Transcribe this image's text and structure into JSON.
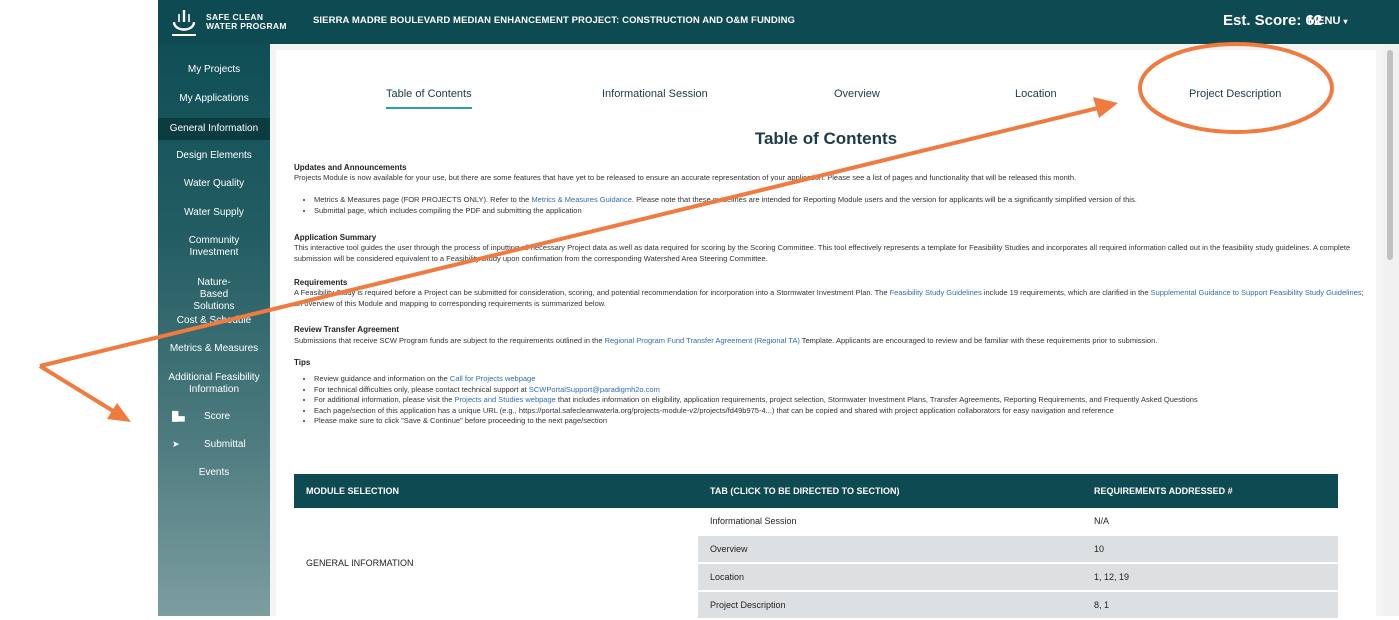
{
  "header": {
    "logo_line1": "SAFE CLEAN",
    "logo_line2": "WATER PROGRAM",
    "project_title": "SIERRA MADRE BOULEVARD MEDIAN ENHANCEMENT PROJECT:  CONSTRUCTION AND O&M FUNDING",
    "score": "Est. Score: 62",
    "menu": "MENU"
  },
  "sidebar": {
    "items": [
      {
        "label": "My Projects"
      },
      {
        "label": "My Applications"
      },
      {
        "label": "General Information"
      },
      {
        "label": "Design Elements"
      },
      {
        "label": "Water Quality"
      },
      {
        "label": "Water Supply"
      },
      {
        "label": "Community Investment"
      },
      {
        "label": "Nature-Based Solutions"
      },
      {
        "label": "Cost & Schedule"
      },
      {
        "label": "Metrics & Measures"
      },
      {
        "label": "Additional Feasibility Information"
      },
      {
        "label": "Score"
      },
      {
        "label": "Submittal"
      },
      {
        "label": "Events"
      }
    ]
  },
  "tabs": [
    {
      "label": "Table of Contents"
    },
    {
      "label": "Informational Session"
    },
    {
      "label": "Overview"
    },
    {
      "label": "Location"
    },
    {
      "label": "Project Description"
    }
  ],
  "content": {
    "heading": "Table of Contents",
    "updates_title": "Updates and Announcements",
    "updates_text": "Projects Module is now available for your use, but there are some features that have yet to be released to ensure an accurate representation of your application. Please see a list of pages and functionality that will be released this month.",
    "updates_b1_pre": "Metrics & Measures page (FOR PROJECTS ONLY). Refer to the ",
    "updates_b1_link": "Metrics & Measures Guidance",
    "updates_b1_post": ". Please note that these guidelines are intended for Reporting Module users and the version for applicants will be a significantly simplified version of this.",
    "updates_b2": "Submittal page, which includes compiling the PDF and submitting the application",
    "summary_title": "Application Summary",
    "summary_text": "This interactive tool guides the user through the process of inputting all necessary Project data as well as data required for scoring by the Scoring Committee. This tool effectively represents a template for Feasibility Studies and incorporates all required information called out in the feasibility study guidelines. A complete submission will be considered equivalent to a Feasibility Study upon confirmation from the corresponding Watershed Area Steering Committee.",
    "req_title": "Requirements",
    "req_pre": "A Feasibility Study is required before a Project can be submitted for consideration, scoring, and potential recommendation for incorporation into a Stormwater Investment Plan. The ",
    "req_link1": "Feasibility Study Guidelines",
    "req_mid": " include 19 requirements, which are clarified in the ",
    "req_link2": "Supplemental Guidance to Support Feasibility Study Guidelines",
    "req_post": "; an overview of this Module and mapping to corresponding requirements is summarized below.",
    "transfer_title": "Review Transfer Agreement",
    "transfer_pre": "Submissions that receive SCW Program funds are subject to the requirements outlined in the ",
    "transfer_link": "Regional Program Fund Transfer Agreement (Regional TA)",
    "transfer_post": " Template. Applicants are encouraged to review and be familiar with these requirements prior to submission.",
    "tips_title": "Tips",
    "tip1_pre": "Review guidance and information on the ",
    "tip1_link": "Call for Projects webpage",
    "tip2_pre": "For technical difficulties only, please contact technical support at ",
    "tip2_link": "SCWPortalSupport@paradigmh2o.com",
    "tip3_pre": "For additional information, please visit the ",
    "tip3_link": "Projects and Studies webpage",
    "tip3_post": " that includes information on eligibility, application requirements, project selection, Stormwater Investment Plans, Transfer Agreements, Reporting Requirements, and Frequently Asked Questions",
    "tip4": "Each page/section of this application has a unique URL (e.g., https://portal.safecleanwaterla.org/projects-module-v2/projects/fd49b975-4...) that can be copied and shared with project application collaborators for easy navigation and reference",
    "tip5": "Please make sure to click \"Save & Continue\" before proceeding to the next page/section"
  },
  "table": {
    "headers": [
      "MODULE SELECTION",
      "TAB (CLICK TO BE DIRECTED TO SECTION)",
      "REQUIREMENTS ADDRESSED #"
    ],
    "group_label": "GENERAL INFORMATION",
    "rows": [
      {
        "tab": "Informational Session",
        "req": "N/A"
      },
      {
        "tab": "Overview",
        "req": "10"
      },
      {
        "tab": "Location",
        "req": "1, 12, 19"
      },
      {
        "tab": "Project Description",
        "req": "8, 1"
      }
    ]
  },
  "colors": {
    "brand_teal": "#0e4a51",
    "accent_teal": "#2aa2a5",
    "annotation_orange": "#f07b3f",
    "link_blue": "#2f6db5"
  }
}
